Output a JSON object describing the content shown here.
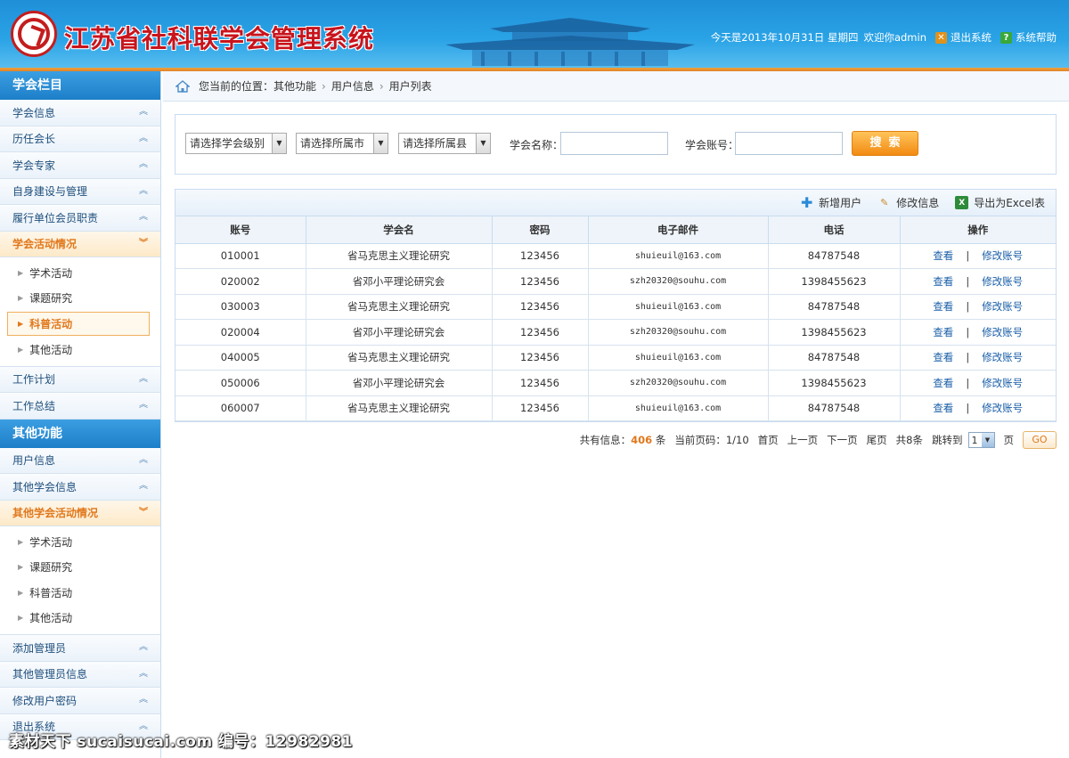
{
  "header": {
    "title": "江苏省社科联学会管理系统",
    "date_text": "今天是2013年10月31日 星期四",
    "welcome": "欢迎你admin",
    "logout": "退出系统",
    "help": "系统帮助"
  },
  "sidebar": {
    "section1_title": "学会栏目",
    "items1": [
      {
        "label": "学会信息"
      },
      {
        "label": "历任会长"
      },
      {
        "label": "学会专家"
      },
      {
        "label": "自身建设与管理"
      },
      {
        "label": "履行单位会员职责"
      },
      {
        "label": "学会活动情况"
      }
    ],
    "sub1": [
      {
        "label": "学术活动"
      },
      {
        "label": "课题研究"
      },
      {
        "label": "科普活动"
      },
      {
        "label": "其他活动"
      }
    ],
    "items1b": [
      {
        "label": "工作计划"
      },
      {
        "label": "工作总结"
      }
    ],
    "section2_title": "其他功能",
    "items2": [
      {
        "label": "用户信息"
      },
      {
        "label": "其他学会信息"
      },
      {
        "label": "其他学会活动情况"
      }
    ],
    "sub2": [
      {
        "label": "学术活动"
      },
      {
        "label": "课题研究"
      },
      {
        "label": "科普活动"
      },
      {
        "label": "其他活动"
      }
    ],
    "items2b": [
      {
        "label": "添加管理员"
      },
      {
        "label": "其他管理员信息"
      },
      {
        "label": "修改用户密码"
      },
      {
        "label": "退出系统"
      }
    ]
  },
  "breadcrumb": {
    "prefix": "您当前的位置：",
    "items": [
      "其他功能",
      "用户信息",
      "用户列表"
    ]
  },
  "search": {
    "level_select": "请选择学会级别",
    "city_select": "请选择所属市",
    "county_select": "请选择所属县",
    "name_label": "学会名称：",
    "name_value": "",
    "account_label": "学会账号：",
    "account_value": "",
    "button": "搜索"
  },
  "toolbar": {
    "add": "新增用户",
    "edit": "修改信息",
    "export": "导出为Excel表"
  },
  "table": {
    "headers": [
      "账号",
      "学会名",
      "密码",
      "电子邮件",
      "电话",
      "操作"
    ],
    "rows": [
      [
        "010001",
        "省马克思主义理论研究",
        "123456",
        "shuieuil@163.com",
        "84787548"
      ],
      [
        "020002",
        "省邓小平理论研究会",
        "123456",
        "szh20320@souhu.com",
        "1398455623"
      ],
      [
        "030003",
        "省马克思主义理论研究",
        "123456",
        "shuieuil@163.com",
        "84787548"
      ],
      [
        "020004",
        "省邓小平理论研究会",
        "123456",
        "szh20320@souhu.com",
        "1398455623"
      ],
      [
        "040005",
        "省马克思主义理论研究",
        "123456",
        "shuieuil@163.com",
        "84787548"
      ],
      [
        "050006",
        "省邓小平理论研究会",
        "123456",
        "szh20320@souhu.com",
        "1398455623"
      ],
      [
        "060007",
        "省马克思主义理论研究",
        "123456",
        "shuieuil@163.com",
        "84787548"
      ]
    ],
    "op_view": "查看",
    "op_sep": "|",
    "op_edit": "修改账号"
  },
  "pager": {
    "total_prefix": "共有信息：",
    "total": "406",
    "total_suffix": "条",
    "current": "当前页码：1/10",
    "first": "首页",
    "prev": "上一页",
    "next": "下一页",
    "last": "尾页",
    "count": "共8条",
    "jump": "跳转到",
    "page_value": "1",
    "page_suffix": "页",
    "go": "GO"
  },
  "watermark": "素材天下 sucaisucai.com 编号：12982981",
  "colors": {
    "header_blue": "#1f8fd8",
    "accent_orange": "#e0781c",
    "title_red": "#c8141c",
    "link_blue": "#1a5fa8"
  }
}
